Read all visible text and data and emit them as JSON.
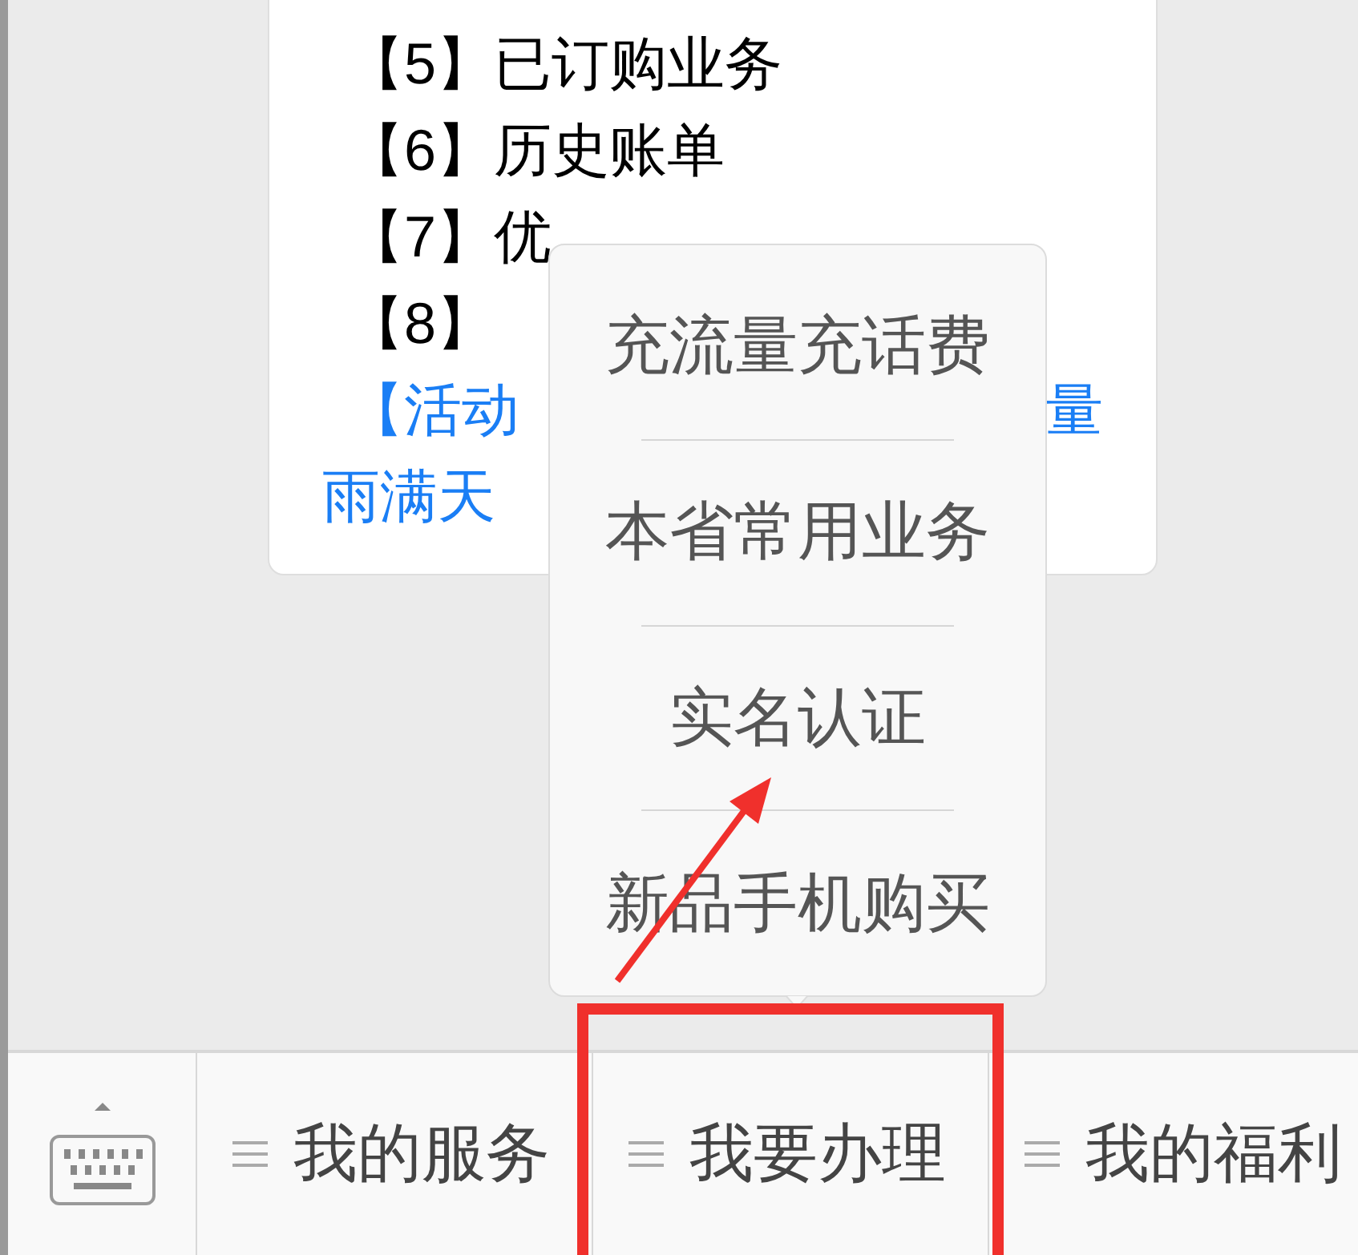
{
  "message": {
    "lines": [
      "【5】已订购业务",
      "【6】历史账单",
      "【7】优",
      "【8】"
    ],
    "activity": {
      "label": "【活动",
      "tail": "量",
      "second_line": "雨满天"
    }
  },
  "popup_menu": {
    "items": [
      "充流量充话费",
      "本省常用业务",
      "实名认证",
      "新品手机购买"
    ]
  },
  "menu_bar": {
    "tabs": [
      {
        "label": "我的服务",
        "highlighted": false
      },
      {
        "label": "我要办理",
        "highlighted": true
      },
      {
        "label": "我的福利",
        "highlighted": false
      }
    ]
  },
  "annotation": {
    "arrow": true
  }
}
